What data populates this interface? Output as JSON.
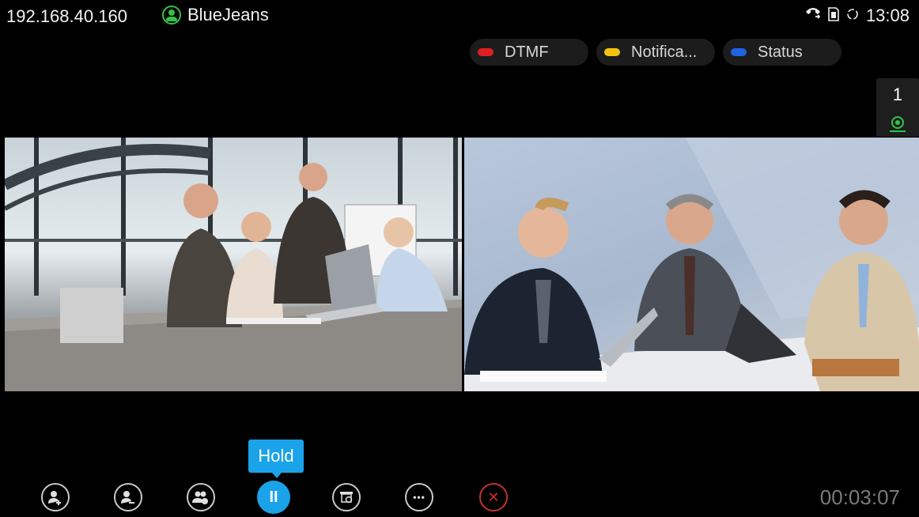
{
  "status_bar": {
    "ip_address": "192.168.40.160",
    "account_name": "BlueJeans",
    "time": "13:08",
    "icons": [
      "call-forward-icon",
      "sd-card-icon",
      "sync-icon"
    ]
  },
  "function_keys": [
    {
      "label": "DTMF",
      "color": "#e02020"
    },
    {
      "label": "Notifica...",
      "color": "#f2c40f"
    },
    {
      "label": "Status",
      "color": "#1f63e0"
    }
  ],
  "participants": {
    "count": "1"
  },
  "hold_tooltip": "Hold",
  "toolbar": {
    "buttons": [
      "add-participant-icon",
      "remove-participant-icon",
      "participants-icon",
      "hold-icon",
      "presentation-icon",
      "more-icon",
      "end-call-icon"
    ],
    "hold_symbol": "II",
    "more_symbol": "•••",
    "end_symbol": "✕"
  },
  "call_duration": "00:03:07",
  "colors": {
    "accent": "#1aa3e8",
    "online": "#31c24a",
    "end_call": "#c23232"
  }
}
